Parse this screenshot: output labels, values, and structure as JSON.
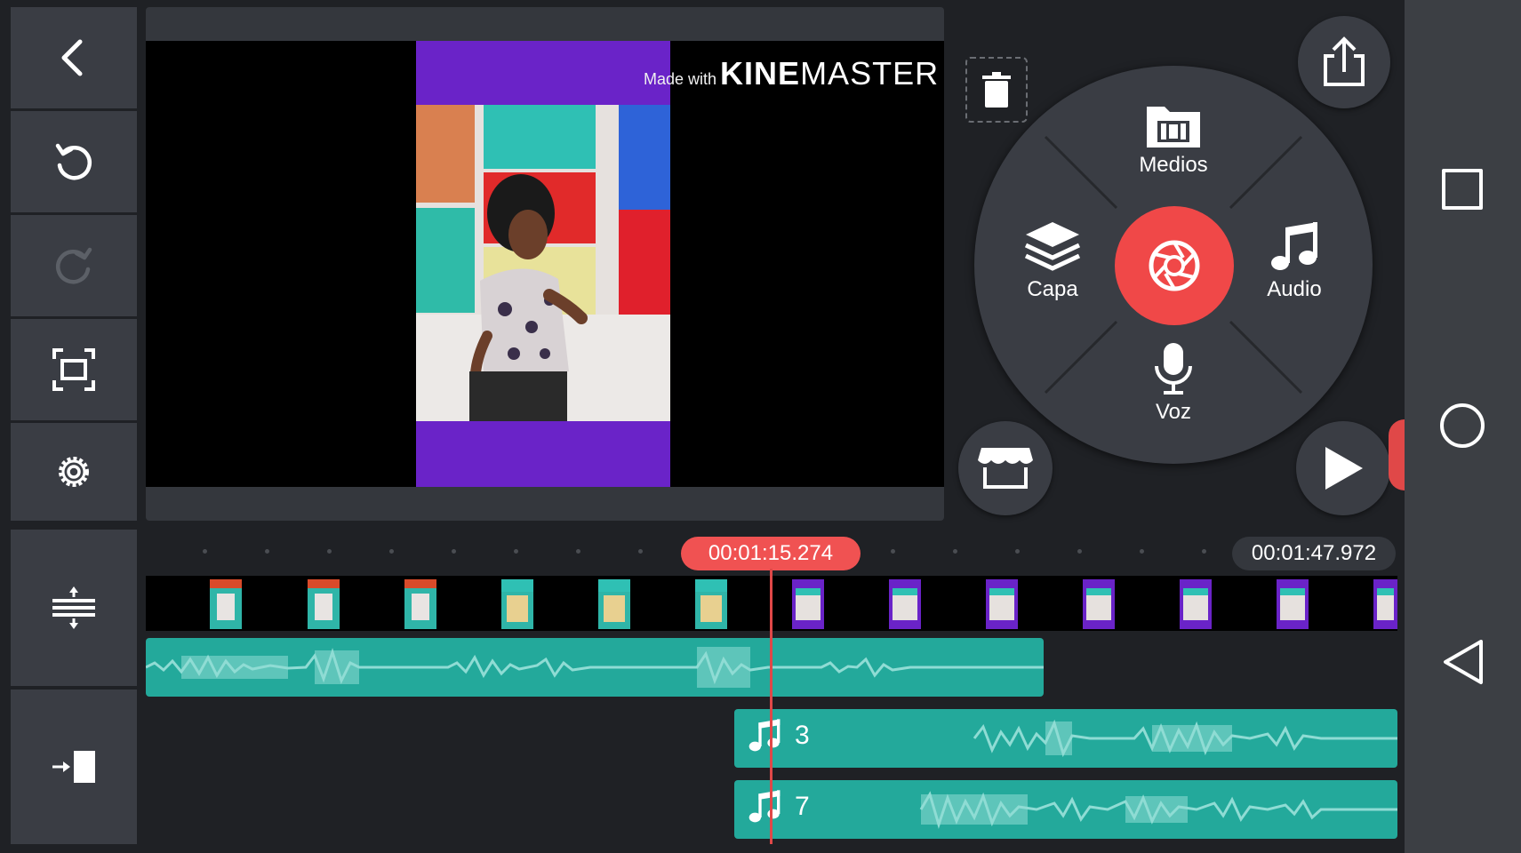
{
  "preview": {
    "watermark_prefix": "Made with",
    "watermark_brand_bold": "KINE",
    "watermark_brand_light": "MASTER"
  },
  "menu": {
    "media_label": "Medios",
    "layer_label": "Capa",
    "audio_label": "Audio",
    "voice_label": "Voz"
  },
  "timeline": {
    "current_time": "00:01:15.274",
    "total_time": "00:01:47.972",
    "audio_clips": [
      {
        "label": "3"
      },
      {
        "label": "7"
      }
    ]
  },
  "colors": {
    "accent_red": "#f04848",
    "audio_teal": "#23a99b",
    "video_purple": "#6a23c8",
    "panel_gray": "#3a3d44"
  },
  "icons": [
    "back-icon",
    "undo-icon",
    "redo-icon",
    "fullscreen-icon",
    "settings-icon",
    "track-height-icon",
    "jump-end-icon",
    "delete-icon",
    "share-icon",
    "store-icon",
    "play-icon",
    "media-folder-icon",
    "layers-icon",
    "music-note-icon",
    "microphone-icon",
    "camera-shutter-icon",
    "recents-icon",
    "home-icon",
    "nav-back-icon"
  ]
}
